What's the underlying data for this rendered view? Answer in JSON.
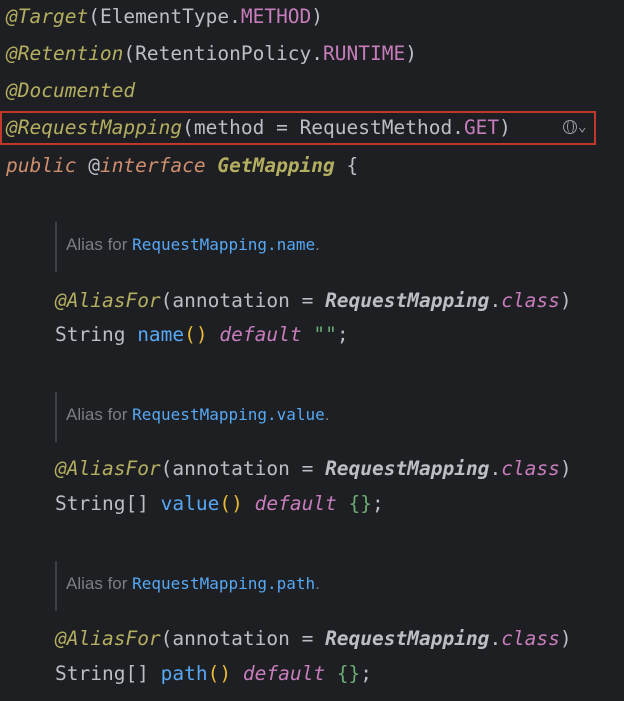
{
  "code": {
    "line1": {
      "at": "@",
      "ann": "Target",
      "open": "(",
      "type": "ElementType.",
      "const": "METHOD",
      "close": ")"
    },
    "line2": {
      "at": "@",
      "ann": "Retention",
      "open": "(",
      "type": "RetentionPolicy.",
      "const": "RUNTIME",
      "close": ")"
    },
    "line3": {
      "at": "@",
      "ann": "Documented"
    },
    "line4": {
      "at": "@",
      "ann": "RequestMapping",
      "open": "(",
      "param": "method",
      "eq": " = ",
      "type": "RequestMethod.",
      "const": "GET",
      "close": ")"
    },
    "line5": {
      "kw": "public",
      "sp": " ",
      "at": "@",
      "ifc": "interface",
      "name": " GetMapping ",
      "brace": "{"
    },
    "doc1": {
      "prefix": "Alias for ",
      "link": "RequestMapping.name",
      "suffix": "."
    },
    "alias1": {
      "at": "@",
      "ann": "AliasFor",
      "open": "(",
      "param": "annotation",
      "eq": " = ",
      "cls": "RequestMapping",
      "dot": ".",
      "kw": "class",
      "close": ")"
    },
    "decl1": {
      "type": "String ",
      "method": "name",
      "parens": "()",
      "sp": " ",
      "default": "default",
      "sp2": " ",
      "val": "\"\"",
      "semi": ";"
    },
    "doc2": {
      "prefix": "Alias for ",
      "link": "RequestMapping.value",
      "suffix": "."
    },
    "alias2": {
      "at": "@",
      "ann": "AliasFor",
      "open": "(",
      "param": "annotation",
      "eq": " = ",
      "cls": "RequestMapping",
      "dot": ".",
      "kw": "class",
      "close": ")"
    },
    "decl2": {
      "type": "String[] ",
      "method": "value",
      "parens": "()",
      "sp": " ",
      "default": "default",
      "sp2": " ",
      "val": "{}",
      "semi": ";"
    },
    "doc3": {
      "prefix": "Alias for ",
      "link": "RequestMapping.path",
      "suffix": "."
    },
    "alias3": {
      "at": "@",
      "ann": "AliasFor",
      "open": "(",
      "param": "annotation",
      "eq": " = ",
      "cls": "RequestMapping",
      "dot": ".",
      "kw": "class",
      "close": ")"
    },
    "decl3": {
      "type": "String[] ",
      "method": "path",
      "parens": "()",
      "sp": " ",
      "default": "default",
      "sp2": " ",
      "val": "{}",
      "semi": ";"
    }
  },
  "icons": {
    "web_endpoint": "globe-icon",
    "dropdown": "chevron-down-icon",
    "chevron": "⌄"
  },
  "colors": {
    "background": "#1e1f22",
    "annotation": "#b3ae60",
    "keyword": "#cf8e6d",
    "constant": "#c77dbb",
    "method": "#56a8f5",
    "string": "#6aab73",
    "highlight_border": "#c0392b"
  }
}
